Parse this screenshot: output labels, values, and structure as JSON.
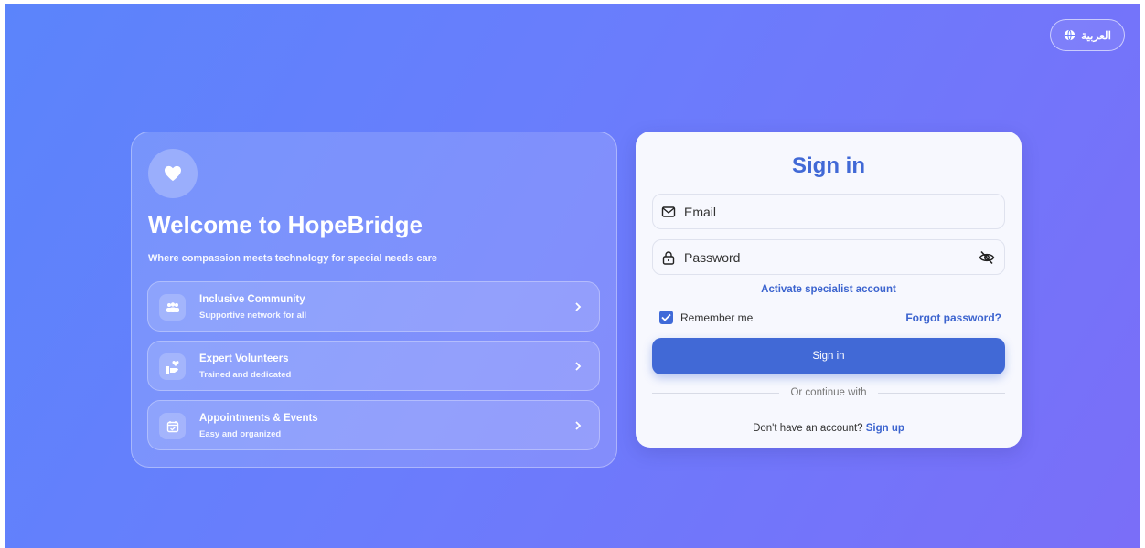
{
  "language_button": {
    "label": "العربية",
    "icon": "globe-icon"
  },
  "welcome": {
    "icon": "heart-icon",
    "title": "Welcome to HopeBridge",
    "subtitle": "Where compassion meets technology for special needs care",
    "features": [
      {
        "title": "Inclusive Community",
        "desc": "Supportive network for all",
        "icon": "people-icon"
      },
      {
        "title": "Expert Volunteers",
        "desc": "Trained and dedicated",
        "icon": "volunteer-hand-icon"
      },
      {
        "title": "Appointments & Events",
        "desc": "Easy and organized",
        "icon": "calendar-icon"
      }
    ]
  },
  "signin": {
    "title": "Sign in",
    "email_placeholder": "Email",
    "password_placeholder": "Password",
    "activate_link": "Activate specialist account",
    "remember_label": "Remember me",
    "remember_checked": true,
    "forgot_link": "Forgot password?",
    "submit_label": "Sign in",
    "divider_text": "Or continue with",
    "no_account_text": "Don't have an account?",
    "signup_link": "Sign up"
  },
  "colors": {
    "accent": "#4169d6",
    "background_start": "#5b84fb",
    "background_end": "#7a6ef8"
  }
}
